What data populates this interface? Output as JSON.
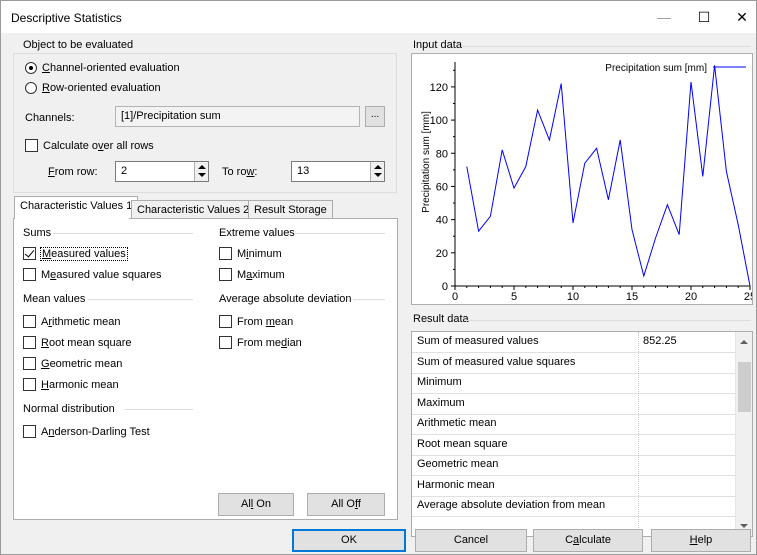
{
  "window": {
    "title": "Descriptive Statistics",
    "minimize": "—",
    "maximize": "☐",
    "close": "✕"
  },
  "object_group": {
    "label": "Object to be evaluated",
    "radio_channel": {
      "pre": "",
      "u": "C",
      "post": "hannel-oriented evaluation",
      "selected": true
    },
    "radio_row": {
      "pre": "",
      "u": "R",
      "post": "ow-oriented evaluation",
      "selected": false
    },
    "channels_label": "Channels:",
    "channels_value": "[1]/Precipitation sum",
    "browse_label": "...",
    "calc_all_rows": {
      "pre": "Calculate o",
      "u": "v",
      "post": "er all rows",
      "checked": false
    },
    "from_row_label": {
      "pre": "",
      "u": "F",
      "post": "rom row:"
    },
    "from_row_value": "2",
    "to_row_label": {
      "pre": "To ro",
      "u": "w",
      "post": ":"
    },
    "to_row_value": "13"
  },
  "tabs": [
    {
      "label": "Characteristic Values 1",
      "active": true
    },
    {
      "label": "Characteristic Values 2",
      "active": false
    },
    {
      "label": "Result Storage",
      "active": false
    }
  ],
  "panel": {
    "sums_header": "Sums",
    "extreme_header": "Extreme values",
    "mean_header": "Mean values",
    "avg_dev_header": "Average absolute deviation",
    "normal_header": "Normal distribution",
    "measured_values": {
      "pre": "",
      "u": "M",
      "post": "easured values",
      "checked": true
    },
    "measured_squares": {
      "pre": "M",
      "u": "e",
      "post": "asured value squares",
      "checked": false
    },
    "minimum": {
      "pre": "M",
      "u": "i",
      "post": "nimum",
      "checked": false
    },
    "maximum": {
      "pre": "M",
      "u": "a",
      "post": "ximum",
      "checked": false
    },
    "arithmetic": {
      "pre": "A",
      "u": "r",
      "post": "ithmetic mean",
      "checked": false
    },
    "root": {
      "pre": "",
      "u": "R",
      "post": "oot mean square",
      "checked": false
    },
    "geometric": {
      "pre": "",
      "u": "G",
      "post": "eometric mean",
      "checked": false
    },
    "harmonic": {
      "pre": "",
      "u": "H",
      "post": "armonic mean",
      "checked": false
    },
    "from_mean": {
      "pre": "From ",
      "u": "m",
      "post": "ean",
      "checked": false
    },
    "from_median": {
      "pre": "From me",
      "u": "d",
      "post": "ian",
      "checked": false
    },
    "anderson": {
      "pre": "A",
      "u": "n",
      "post": "derson-Darling Test",
      "checked": false
    },
    "all_on": {
      "pre": "Al",
      "u": "l",
      "post": " On"
    },
    "all_off": {
      "pre": "All O",
      "u": "f",
      "post": "f"
    }
  },
  "input_data_label": "Input data",
  "result_data_label": "Result data",
  "results": [
    {
      "name": "Sum of measured values",
      "value": "852.25"
    },
    {
      "name": "Sum of measured value squares",
      "value": ""
    },
    {
      "name": "Minimum",
      "value": ""
    },
    {
      "name": "Maximum",
      "value": ""
    },
    {
      "name": "Arithmetic mean",
      "value": ""
    },
    {
      "name": "Root mean square",
      "value": ""
    },
    {
      "name": "Geometric mean",
      "value": ""
    },
    {
      "name": "Harmonic mean",
      "value": ""
    },
    {
      "name": "Average absolute deviation from mean",
      "value": ""
    }
  ],
  "buttons": {
    "ok": "OK",
    "cancel": "Cancel",
    "calculate": {
      "pre": "C",
      "u": "a",
      "post": "lculate"
    },
    "help": {
      "pre": "",
      "u": "H",
      "post": "elp"
    }
  },
  "colors": {
    "series": "#0000ff",
    "accent": "#0078d7"
  },
  "chart_data": {
    "type": "line",
    "title": "",
    "xlabel": "",
    "ylabel": "Precipitation sum [mm]",
    "xlim": [
      0,
      25
    ],
    "ylim": [
      0,
      135
    ],
    "xticks": [
      0,
      5,
      10,
      15,
      20,
      25
    ],
    "yticks": [
      0,
      20,
      40,
      60,
      80,
      100,
      120
    ],
    "legend_position": "top-right",
    "grid": false,
    "series": [
      {
        "name": "Precipitation sum [mm]",
        "x": [
          1,
          2,
          3,
          4,
          5,
          6,
          7,
          8,
          9,
          10,
          11,
          12,
          13,
          14,
          15,
          16,
          17,
          18,
          19,
          20,
          21,
          22,
          23,
          24,
          25
        ],
        "y": [
          72,
          33,
          42,
          82,
          59,
          72,
          106,
          88,
          122,
          38,
          74,
          83,
          52,
          88,
          34,
          6,
          29,
          49,
          31,
          123,
          66,
          133,
          69,
          37,
          0
        ]
      }
    ]
  }
}
